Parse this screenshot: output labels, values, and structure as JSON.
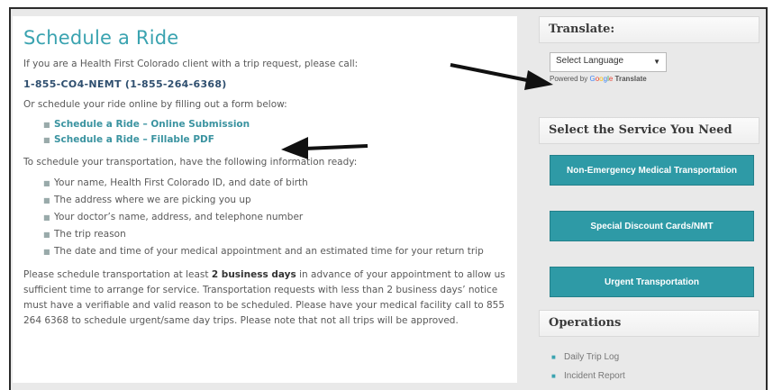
{
  "main": {
    "title": "Schedule a Ride",
    "intro": "If you are a Health First Colorado client with a trip request, please call:",
    "phone": "1-855-CO4-NEMT (1-855-264-6368)",
    "online_prompt": "Or schedule your ride online by filling out a form below:",
    "links": [
      "Schedule a Ride – Online Submission",
      "Schedule a Ride – Fillable PDF"
    ],
    "info_prompt": "To schedule your transportation, have the following information ready:",
    "info_items": [
      "Your name, Health First Colorado ID, and date of birth",
      "The address where we are picking you up",
      "Your doctor’s name, address, and telephone number",
      "The trip reason",
      "The date and time of your medical appointment and an estimated time for your return trip"
    ],
    "notice_pre": "Please schedule transportation at least ",
    "notice_bold": "2 business days",
    "notice_post": " in advance of your appointment to allow us sufficient time to arrange for service. Transportation requests with less than 2 business days’ notice must have a verifiable and valid reason to be scheduled.  Please have your medical facility call to 855 264 6368 to schedule urgent/same day trips.  Please note that not all trips will be approved."
  },
  "sidebar": {
    "translate_title": "Translate:",
    "language_select": "Select Language",
    "powered_by": "Powered by",
    "google_letters": [
      "G",
      "o",
      "o",
      "g",
      "l",
      "e"
    ],
    "translate_word": "Translate",
    "services_title": "Select the Service You Need",
    "service_buttons": [
      "Non-Emergency Medical Transportation",
      "Special Discount Cards/NMT",
      "Urgent Transportation"
    ],
    "operations_title": "Operations",
    "operations_items": [
      "Daily Trip Log",
      "Incident Report"
    ]
  },
  "colors": {
    "accent": "#3aa3b0",
    "button": "#2e9aa6",
    "arrow": "#111111"
  }
}
